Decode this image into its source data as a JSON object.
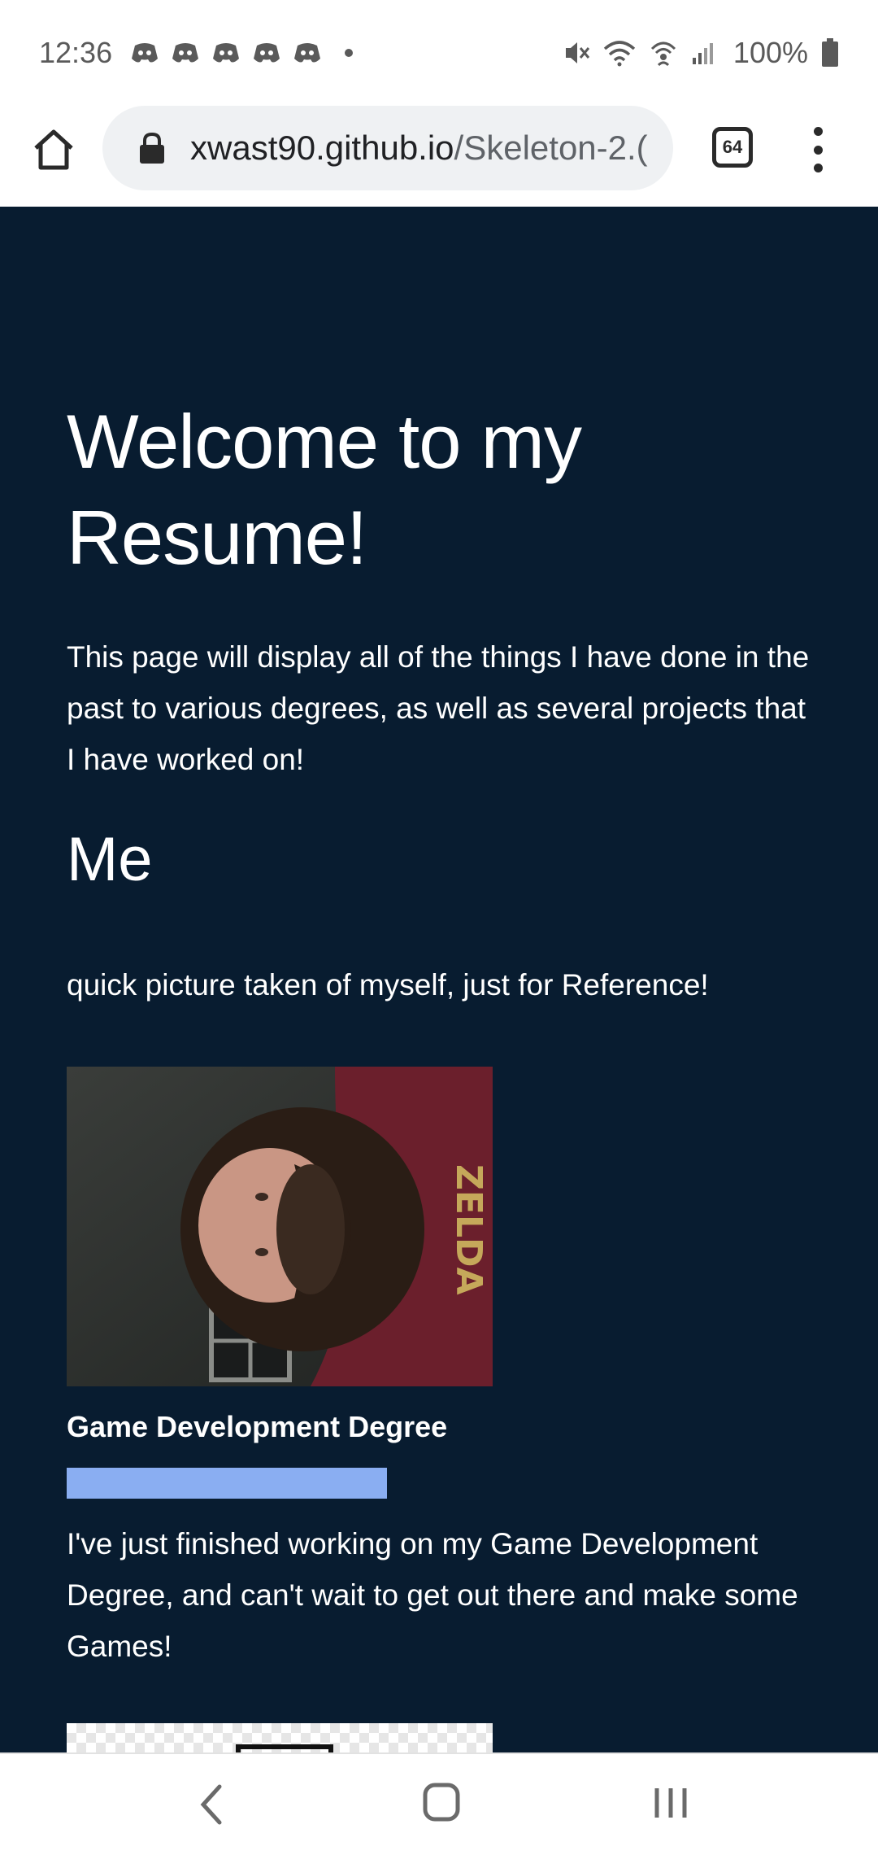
{
  "status_bar": {
    "time": "12:36",
    "battery_percent": "100%",
    "notification_count": 5,
    "icons": [
      "discord-icon",
      "discord-icon",
      "discord-icon",
      "discord-icon",
      "discord-icon",
      "dot-icon",
      "mute-icon",
      "wifi-icon",
      "hotspot-icon",
      "signal-icon",
      "battery-icon"
    ]
  },
  "browser": {
    "url_domain": "xwast90.github.io",
    "url_path": "/Skeleton-2.(",
    "tab_count": "64",
    "icons": [
      "home-icon",
      "lock-icon",
      "tabs-icon",
      "more-vert-icon"
    ]
  },
  "page": {
    "title_line1": "Welcome to my",
    "title_line2": "Resume!",
    "intro": "This page will display all of the things I have done in the past to various degrees, as well as several projects that I have worked on!",
    "section_me": "Me",
    "photo_caption": "quick picture taken of myself, just for Reference!",
    "degree_title": "Game Development Degree",
    "degree_progress_fraction": 1.0,
    "degree_description": "I've just finished working on my Game Development Degree, and can't wait to get out there and make some Games!",
    "colors": {
      "background": "#081c30",
      "progress": "#8aaef2",
      "text": "#ffffff"
    }
  },
  "nav_bar": {
    "icons": [
      "back-icon",
      "home-circle-icon",
      "recents-icon"
    ]
  }
}
